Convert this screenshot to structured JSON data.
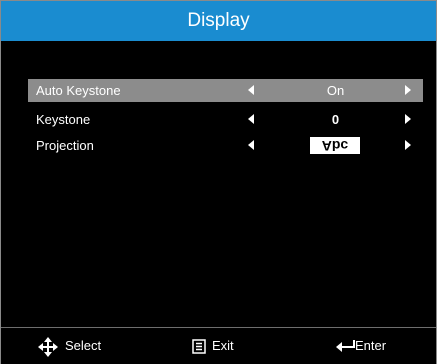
{
  "title": "Display",
  "menu": {
    "rows": [
      {
        "label": "Auto Keystone",
        "value": "On",
        "selected": true
      },
      {
        "label": "Keystone",
        "value": "0",
        "selected": false
      },
      {
        "label": "Projection",
        "value": "Abc",
        "selected": false
      }
    ]
  },
  "footer": {
    "select_label": "Select",
    "select_icon": "move-arrows-icon",
    "exit_label": "Exit",
    "exit_icon": "menu-icon",
    "enter_label": "Enter",
    "enter_icon": "enter-arrow-icon"
  },
  "colors": {
    "title_bar": "#1a8cd0",
    "background": "#000000",
    "selected_row": "#8c8c8c",
    "text": "#ffffff"
  }
}
